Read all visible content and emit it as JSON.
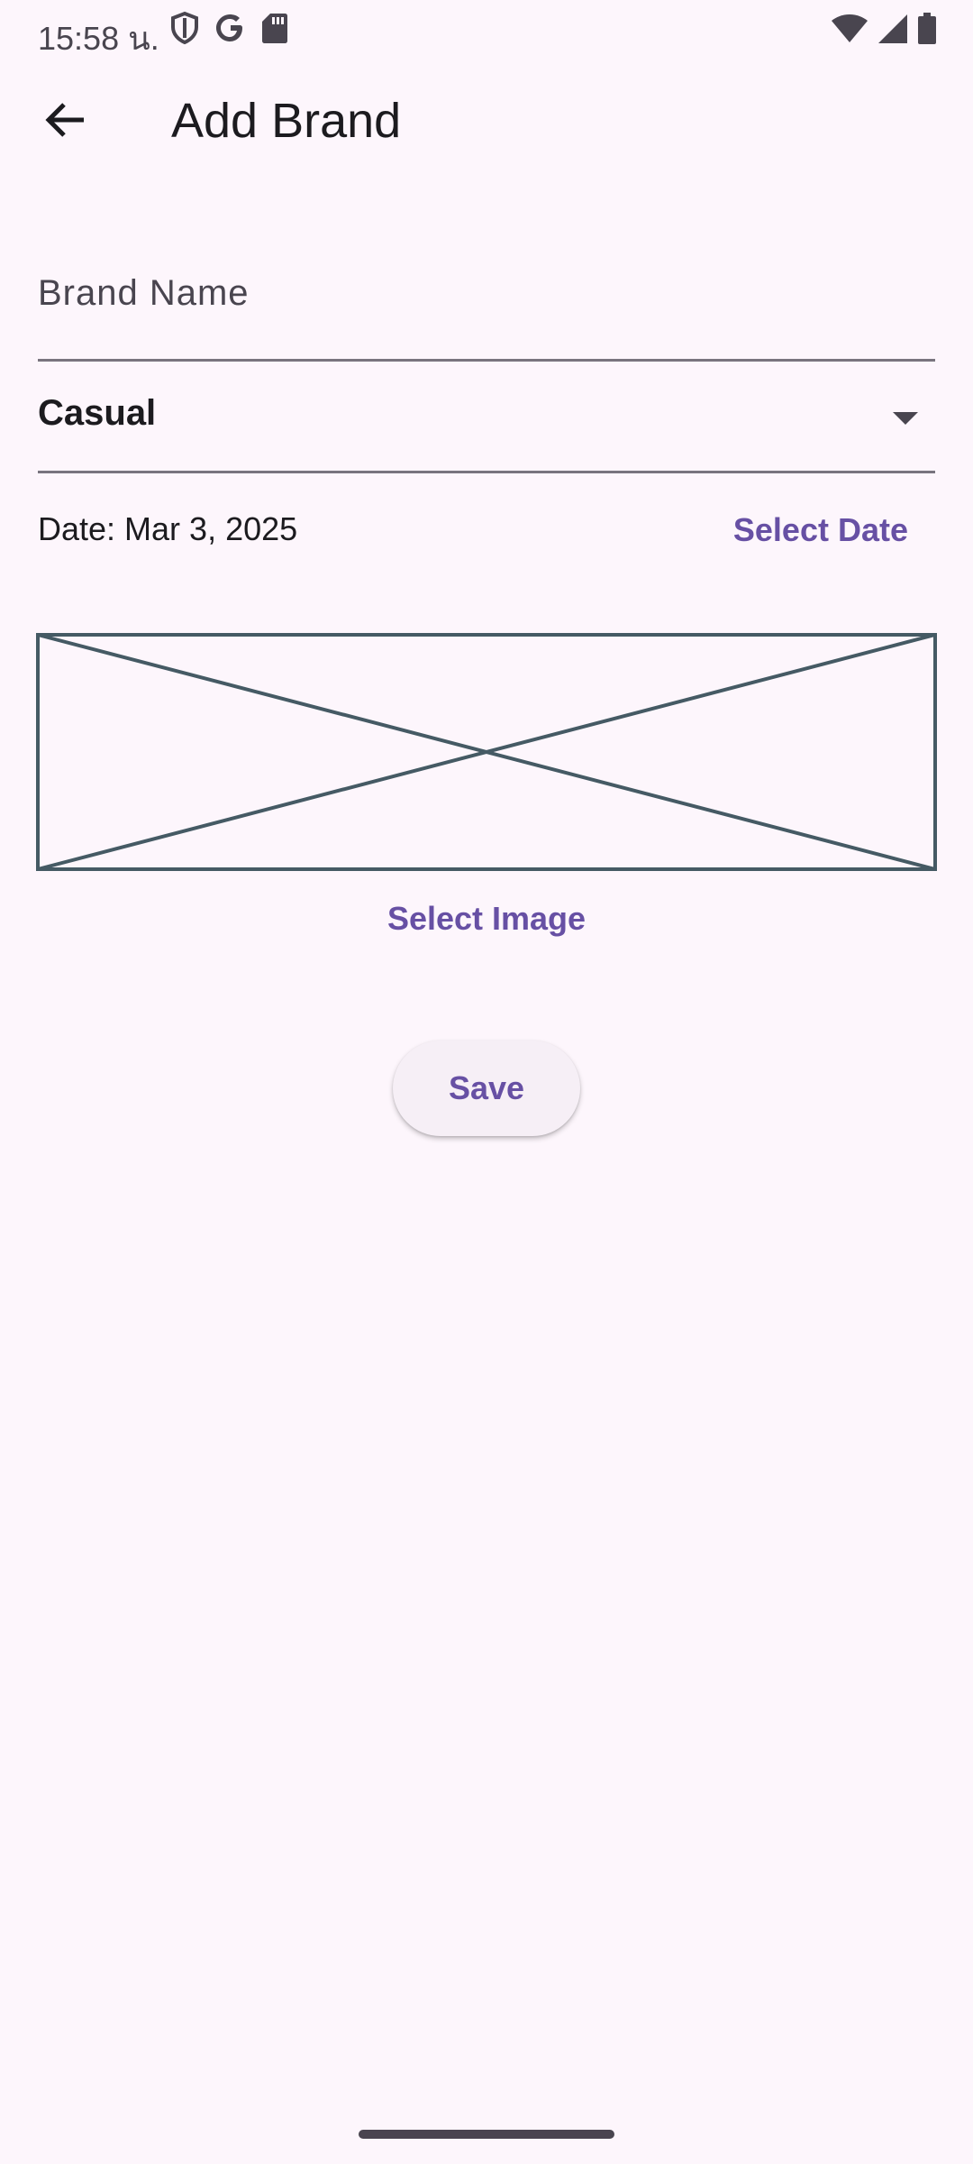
{
  "status_bar": {
    "time": "15:58 น.",
    "left_icons": [
      "shield-icon",
      "google-icon",
      "sd-card-icon"
    ],
    "right_icons": [
      "wifi-icon",
      "cell-signal-icon",
      "battery-icon"
    ]
  },
  "app_bar": {
    "title": "Add Brand",
    "back_icon": "arrow-back-icon"
  },
  "form": {
    "brand_name": {
      "placeholder": "Brand Name",
      "value": ""
    },
    "category": {
      "selected": "Casual",
      "icon": "dropdown-arrow-icon"
    },
    "date": {
      "label": "Date: Mar 3, 2025",
      "select_label": "Select Date"
    },
    "image": {
      "select_label": "Select Image"
    },
    "save_label": "Save"
  },
  "colors": {
    "background": "#fdf6fc",
    "accent": "#6750a4",
    "placeholder_stroke": "#455a64",
    "divider": "#79747e"
  }
}
